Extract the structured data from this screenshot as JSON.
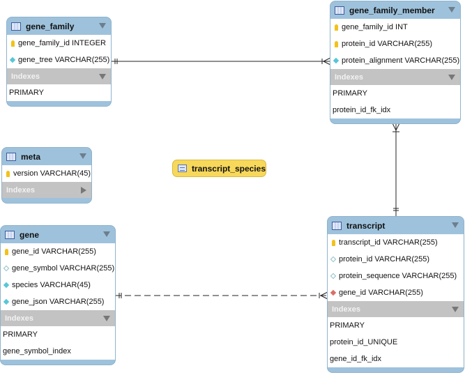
{
  "tables": [
    {
      "name": "gene_family",
      "columns": [
        {
          "text": "gene_family_id INTEGER",
          "icon": "primary-key-icon"
        },
        {
          "text": "gene_tree VARCHAR(255)",
          "icon": "not-null-column-icon"
        }
      ],
      "indexes_label": "Indexes",
      "indexes_expanded": true,
      "indexes": [
        "PRIMARY"
      ]
    },
    {
      "name": "gene_family_member",
      "columns": [
        {
          "text": "gene_family_id INT",
          "icon": "primary-key-icon"
        },
        {
          "text": "protein_id VARCHAR(255)",
          "icon": "primary-key-icon"
        },
        {
          "text": "protein_alignment VARCHAR(255)",
          "icon": "not-null-column-icon"
        }
      ],
      "indexes_label": "Indexes",
      "indexes_expanded": true,
      "indexes": [
        "PRIMARY",
        "protein_id_fk_idx"
      ]
    },
    {
      "name": "meta",
      "columns": [
        {
          "text": "version VARCHAR(45)",
          "icon": "primary-key-icon"
        }
      ],
      "indexes_label": "Indexes",
      "indexes_expanded": false,
      "indexes": []
    },
    {
      "name": "gene",
      "columns": [
        {
          "text": "gene_id VARCHAR(255)",
          "icon": "primary-key-icon"
        },
        {
          "text": "gene_symbol VARCHAR(255)",
          "icon": "nullable-column-icon"
        },
        {
          "text": "species VARCHAR(45)",
          "icon": "not-null-column-icon"
        },
        {
          "text": "gene_json VARCHAR(255)",
          "icon": "not-null-column-icon"
        }
      ],
      "indexes_label": "Indexes",
      "indexes_expanded": true,
      "indexes": [
        "PRIMARY",
        "gene_symbol_index"
      ]
    },
    {
      "name": "transcript",
      "columns": [
        {
          "text": "transcript_id VARCHAR(255)",
          "icon": "primary-key-icon"
        },
        {
          "text": "protein_id VARCHAR(255)",
          "icon": "nullable-column-icon"
        },
        {
          "text": "protein_sequence VARCHAR(255)",
          "icon": "nullable-column-icon"
        },
        {
          "text": "gene_id VARCHAR(255)",
          "icon": "foreign-key-icon"
        }
      ],
      "indexes_label": "Indexes",
      "indexes_expanded": true,
      "indexes": [
        "PRIMARY",
        "protein_id_UNIQUE",
        "gene_id_fk_idx"
      ]
    }
  ],
  "views": [
    {
      "name": "transcript_species",
      "icon": "view-icon"
    }
  ],
  "relationships": [
    {
      "from": "gene_family",
      "to": "gene_family_member",
      "type": "one-to-many",
      "identifying": true
    },
    {
      "from": "gene_family_member",
      "to": "transcript",
      "type": "many-to-one",
      "identifying": true
    },
    {
      "from": "gene",
      "to": "transcript",
      "type": "one-to-many",
      "identifying": false
    }
  ],
  "colors": {
    "header": "#9ec2dc",
    "indexes": "#c3c3c3",
    "view": "#f7d85a",
    "primary_key": "#f2c21a",
    "column": "#58c6d6",
    "foreign_key": "#d96f6a"
  }
}
